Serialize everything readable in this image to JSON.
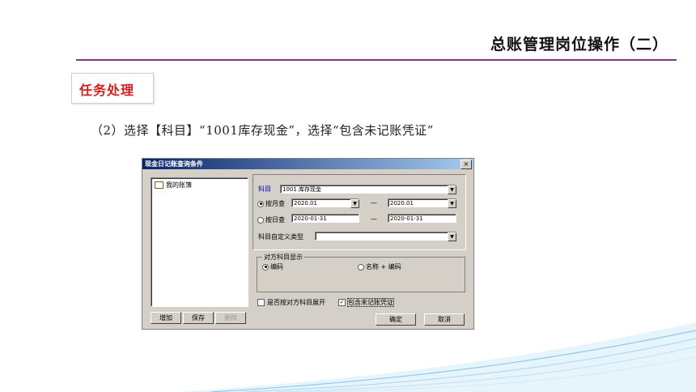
{
  "slide": {
    "title": "总账管理岗位操作（二）",
    "task_label": "任务处理",
    "instruction": "（2）选择【科目】“1001库存现金”，选择“包含未记账凭证”"
  },
  "dialog": {
    "title": "现金日记账查询条件",
    "close_label": "×",
    "tree": {
      "root_label": "我的账簿"
    },
    "buttons": {
      "add": "增加",
      "save": "保存",
      "delete": "删除",
      "ok": "确定",
      "cancel": "取消"
    },
    "subject": {
      "label": "科目",
      "value": "1001 库存现金"
    },
    "by_month": {
      "label": "按月查",
      "selected": true,
      "from": "2020.01",
      "dash": "—",
      "to": "2020.01"
    },
    "by_day": {
      "label": "按日查",
      "selected": false,
      "from": "2020-01-31",
      "dash": "—",
      "to": "2020-01-31"
    },
    "custom_type": {
      "label": "科目自定义类型",
      "value": ""
    },
    "counter_display": {
      "legend": "对方科目显示",
      "options": [
        {
          "label": "编码",
          "selected": true
        },
        {
          "label": "名称 + 编码",
          "selected": false
        }
      ]
    },
    "expand_counter": {
      "label": "是否按对方科目展开",
      "checked": false
    },
    "include_unposted": {
      "label": "包含未记账凭证",
      "checked": true,
      "check_mark": "✓"
    },
    "dropdown_arrow": "▼"
  },
  "colors": {
    "title_rule": "#7b3b8a",
    "task_text": "#d02020",
    "titlebar": "#0a246a",
    "wave": "#8ec9ec"
  }
}
